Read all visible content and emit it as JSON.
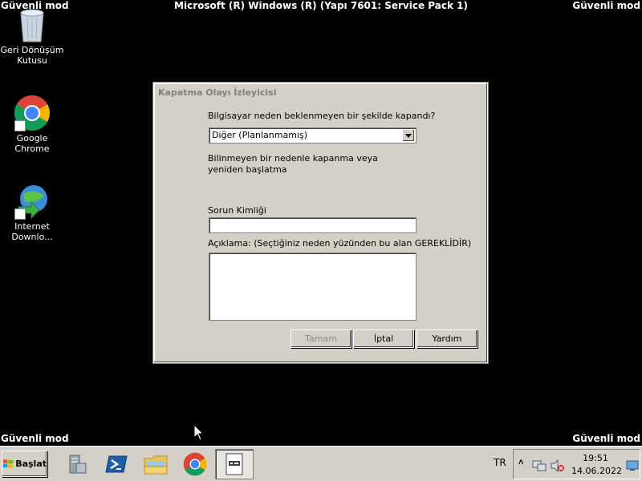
{
  "desktop": {
    "safe_mode_label": "Güvenli mod",
    "os_title": "Microsoft (R) Windows (R) (Yapı 7601: Service Pack 1)",
    "icons": [
      {
        "label": "Geri Dönüşüm Kutusu",
        "icon": "recycle-bin-icon"
      },
      {
        "label": "Google Chrome",
        "icon": "chrome-icon"
      },
      {
        "label": "Internet Downlo...",
        "icon": "internet-download-manager-icon"
      }
    ]
  },
  "dialog": {
    "title": "Kapatma Olayı İzleyicisi",
    "question": "Bilgisayar neden beklenmeyen bir şekilde kapandı?",
    "reason_selected": "Diğer (Planlanmamış)",
    "reason_description": "Bilinmeyen bir nedenle kapanma veya yeniden başlatma",
    "problem_id_label": "Sorun Kimliği",
    "problem_id_value": "",
    "comment_label": "Açıklama: (Seçtiğiniz neden yüzünden bu alan GEREKLİDİR)",
    "comment_value": "",
    "buttons": {
      "ok": "Tamam",
      "cancel": "İptal",
      "help": "Yardım"
    }
  },
  "taskbar": {
    "start_label": "Başlat",
    "apps": [
      "server-manager-icon",
      "powershell-icon",
      "windows-explorer-icon",
      "chrome-icon",
      "shutdown-tracker-icon"
    ],
    "language": "TR",
    "clock_time": "19:51",
    "clock_date": "14.06.2022"
  },
  "colors": {
    "desktop_bg": "#000000",
    "dialog_bg": "#d4d0c8",
    "disabled_text": "#8a8a8a"
  }
}
